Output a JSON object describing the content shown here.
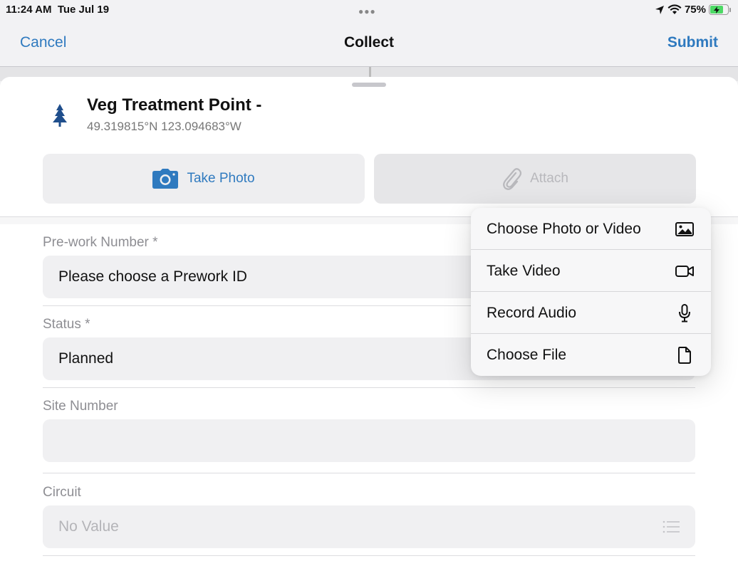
{
  "status_bar": {
    "time": "11:24 AM",
    "date": "Tue Jul 19",
    "battery_percent": "75%",
    "battery_level": 0.75
  },
  "nav": {
    "cancel_label": "Cancel",
    "title": "Collect",
    "submit_label": "Submit"
  },
  "feature": {
    "icon": "tree-icon",
    "title": "Veg Treatment Point -",
    "coords": "49.319815°N  123.094683°W"
  },
  "actions": {
    "take_photo_label": "Take Photo",
    "attach_label": "Attach"
  },
  "fields": [
    {
      "label": "Pre-work Number *",
      "value": "Please choose a Prework ID",
      "placeholder": false
    },
    {
      "label": "Status *",
      "value": "Planned",
      "placeholder": false
    },
    {
      "label": "Site Number",
      "value": "",
      "placeholder": false
    },
    {
      "label": "Circuit",
      "value": "No Value",
      "placeholder": true
    }
  ],
  "attach_menu": {
    "items": [
      {
        "label": "Choose Photo or Video",
        "icon": "photo-icon"
      },
      {
        "label": "Take Video",
        "icon": "video-camera-icon"
      },
      {
        "label": "Record Audio",
        "icon": "microphone-icon"
      },
      {
        "label": "Choose File",
        "icon": "document-icon"
      }
    ]
  },
  "colors": {
    "accent": "#2f7abf",
    "tree": "#1f4e8c",
    "battery": "#4cd964"
  }
}
